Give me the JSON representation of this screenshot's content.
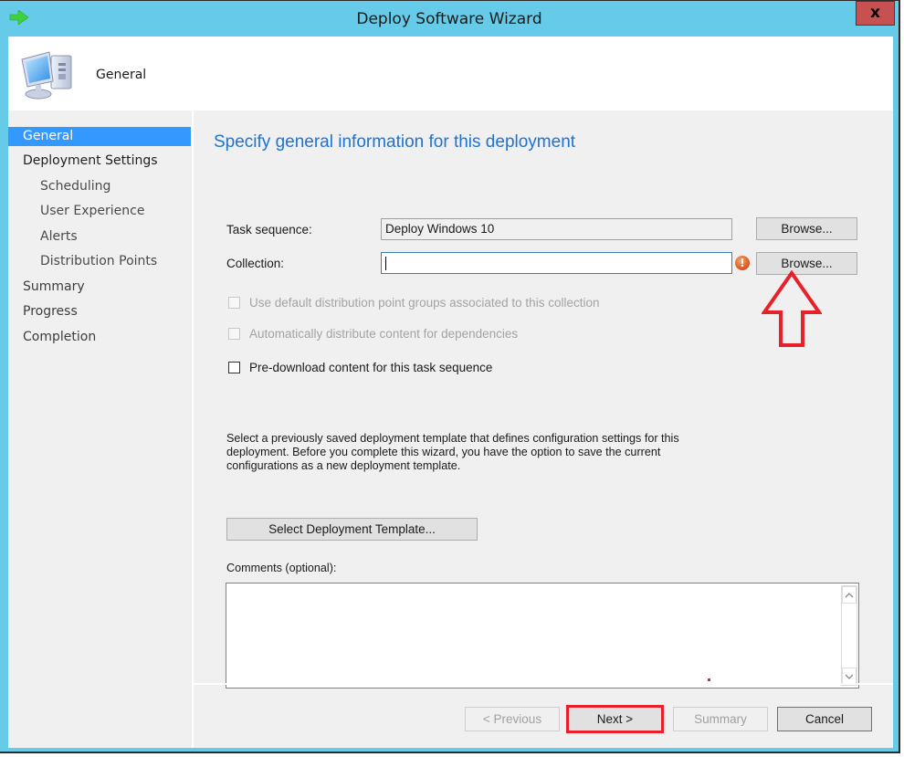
{
  "window": {
    "title": "Deploy Software Wizard",
    "title_icon": "green-arrow-icon",
    "close_label": "x",
    "accent_color": "#65cbe9"
  },
  "header": {
    "icon": "computer-icon",
    "title": "General"
  },
  "sidebar": {
    "items": [
      {
        "label": "General",
        "active": true,
        "level": 0
      },
      {
        "label": "Deployment Settings",
        "active": false,
        "level": 0
      },
      {
        "label": "Scheduling",
        "active": false,
        "level": 1
      },
      {
        "label": "User Experience",
        "active": false,
        "level": 1
      },
      {
        "label": "Alerts",
        "active": false,
        "level": 1
      },
      {
        "label": "Distribution Points",
        "active": false,
        "level": 1
      },
      {
        "label": "Summary",
        "active": false,
        "level": 0
      },
      {
        "label": "Progress",
        "active": false,
        "level": 0
      },
      {
        "label": "Completion",
        "active": false,
        "level": 0
      }
    ],
    "selected_color": "#3399ff"
  },
  "main": {
    "heading": "Specify general information for this deployment",
    "task_sequence": {
      "label": "Task sequence:",
      "value": "Deploy Windows 10",
      "browse_label": "Browse..."
    },
    "collection": {
      "label": "Collection:",
      "value": "",
      "browse_label": "Browse...",
      "validation_icon": "warning-icon",
      "validation_glyph": "!"
    },
    "checkboxes": [
      {
        "label": "Use default distribution point groups associated to this collection",
        "checked": false,
        "enabled": false
      },
      {
        "label": "Automatically distribute content for dependencies",
        "checked": false,
        "enabled": false
      },
      {
        "label": "Pre-download content for this task sequence",
        "checked": false,
        "enabled": true
      }
    ],
    "template_description": "Select a previously saved deployment template that defines configuration settings for this deployment. Before you complete this wizard, you have the option to save the current configurations as a new deployment template.",
    "select_template_label": "Select Deployment Template...",
    "comments": {
      "label": "Comments (optional):",
      "value": ""
    }
  },
  "footer": {
    "previous_label": "< Previous",
    "next_label": "Next >",
    "summary_label": "Summary",
    "cancel_label": "Cancel"
  },
  "annotations": {
    "arrow_color": "#e8202a",
    "highlight_color": "#e8202a"
  }
}
